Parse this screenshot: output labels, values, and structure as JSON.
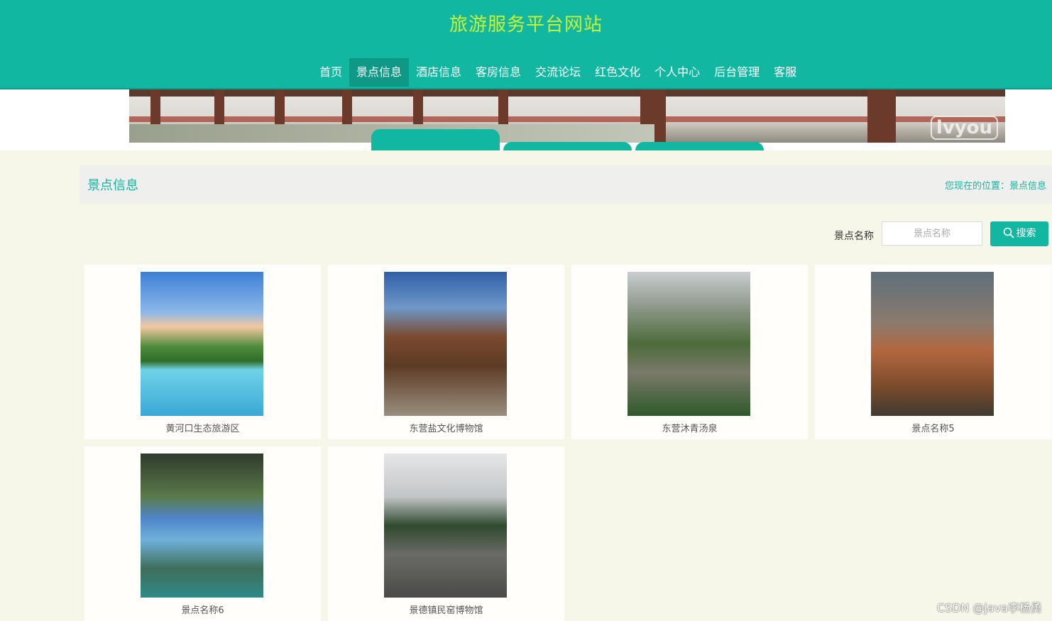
{
  "site": {
    "title": "旅游服务平台网站"
  },
  "nav": {
    "items": [
      {
        "label": "首页"
      },
      {
        "label": "景点信息",
        "active": true
      },
      {
        "label": "酒店信息"
      },
      {
        "label": "客房信息"
      },
      {
        "label": "交流论坛"
      },
      {
        "label": "红色文化"
      },
      {
        "label": "个人中心"
      },
      {
        "label": "后台管理"
      },
      {
        "label": "客服"
      }
    ]
  },
  "banner": {
    "watermark": "lvyou"
  },
  "section": {
    "title": "景点信息",
    "breadcrumb_prefix": "您现在的位置：",
    "breadcrumb_current": "景点信息"
  },
  "search": {
    "label": "景点名称",
    "placeholder": "景点名称",
    "value": "",
    "button_label": "搜索"
  },
  "cards": [
    {
      "name": "黄河口生态旅游区"
    },
    {
      "name": "东营盐文化博物馆"
    },
    {
      "name": "东营沐青汤泉"
    },
    {
      "name": "景点名称5"
    },
    {
      "name": "景点名称6"
    },
    {
      "name": "景德镇民窑博物馆"
    }
  ],
  "watermark": "CSDN @java李杨勇",
  "colors": {
    "primary": "#12b7a2",
    "title": "#c6f233",
    "background": "#f7f7e9"
  }
}
